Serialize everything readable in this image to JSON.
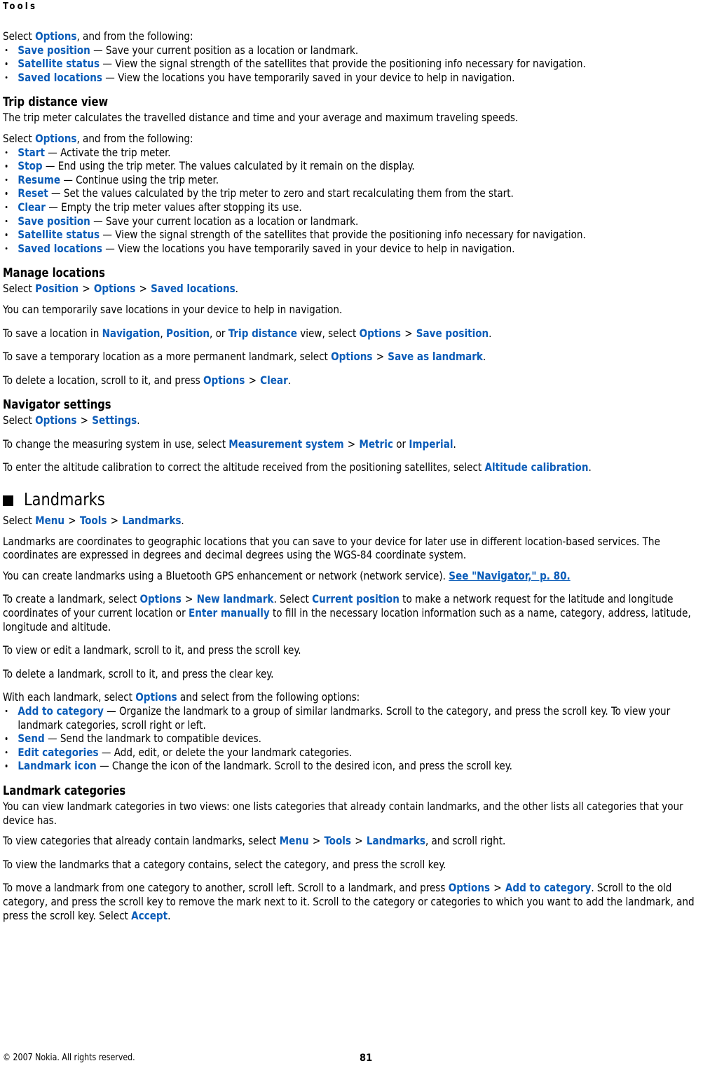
{
  "running_head": "Tools",
  "colors": {
    "ui_term": "#0a5cb8",
    "text": "#000000",
    "background": "#ffffff"
  },
  "position_view": {
    "intro": {
      "pre": "Select ",
      "term": "Options",
      "post": ", and from the following:"
    },
    "items": [
      {
        "term": "Save position",
        "desc": "— Save your current position as a location or landmark."
      },
      {
        "term": "Satellite status",
        "desc": "— View the signal strength of the satellites that provide the positioning info necessary for navigation."
      },
      {
        "term": "Saved locations",
        "desc": "— View the locations you have temporarily saved in your device to help in navigation."
      }
    ]
  },
  "trip_distance": {
    "heading": "Trip distance view",
    "body": "The trip meter calculates the travelled distance and time and your average and maximum traveling speeds.",
    "intro": {
      "pre": "Select ",
      "term": "Options",
      "post": ", and from the following:"
    },
    "items": [
      {
        "term": "Start",
        "desc": "— Activate the trip meter."
      },
      {
        "term": "Stop",
        "desc": "— End using the trip meter. The values calculated by it remain on the display."
      },
      {
        "term": "Resume",
        "desc": "— Continue using the trip meter."
      },
      {
        "term": "Reset",
        "desc": "— Set the values calculated by the trip meter to zero and start recalculating them from the start."
      },
      {
        "term": "Clear",
        "desc": "— Empty the trip meter values after stopping its use."
      },
      {
        "term": "Save position",
        "desc": "— Save your current location as a location or landmark."
      },
      {
        "term": "Satellite status",
        "desc": "— View the signal strength of the satellites that provide the positioning info necessary for navigation."
      },
      {
        "term": "Saved locations",
        "desc": "— View the locations you have temporarily saved in your device to help in navigation."
      }
    ]
  },
  "manage_locations": {
    "heading": "Manage locations",
    "path": {
      "pre": "Select ",
      "t1": "Position",
      "s1": ">",
      "t2": "Options",
      "s2": ">",
      "t3": "Saved locations",
      "post": "."
    },
    "p1": "You can temporarily save locations in your device to help in navigation.",
    "p2": {
      "a": "To save a location in ",
      "t1": "Navigation",
      "b": ", ",
      "t2": "Position",
      "c": ", or ",
      "t3": "Trip distance",
      "d": " view, select ",
      "t4": "Options",
      "s1": ">",
      "t5": "Save position",
      "e": "."
    },
    "p3": {
      "a": "To save a temporary location as a more permanent landmark, select ",
      "t1": "Options",
      "s1": ">",
      "t2": "Save as landmark",
      "b": "."
    },
    "p4": {
      "a": "To delete a location, scroll to it, and press ",
      "t1": "Options",
      "s1": ">",
      "t2": "Clear",
      "b": "."
    }
  },
  "navigator_settings": {
    "heading": "Navigator settings",
    "path": {
      "pre": "Select ",
      "t1": "Options",
      "s1": ">",
      "t2": "Settings",
      "post": "."
    },
    "p1": {
      "a": "To change the measuring system in use, select ",
      "t1": "Measurement system",
      "s1": ">",
      "t2": "Metric",
      "b": " or ",
      "t3": "Imperial",
      "c": "."
    },
    "p2": {
      "a": "To enter the altitude calibration to correct the altitude received from the positioning satellites, select ",
      "t1": "Altitude calibration",
      "b": "."
    }
  },
  "landmarks": {
    "chapter_title": "Landmarks",
    "path": {
      "pre": "Select ",
      "t1": "Menu",
      "s1": ">",
      "t2": "Tools",
      "s2": ">",
      "t3": "Landmarks",
      "post": "."
    },
    "p1": "Landmarks are coordinates to geographic locations that you can save to your device for later use in different location-based services. The coordinates are expressed in degrees and decimal degrees using the WGS-84 coordinate system.",
    "p2": {
      "a": "You can create landmarks using a Bluetooth GPS enhancement or network (network service). ",
      "link": "See \"Navigator,\" p. 80."
    },
    "p3": {
      "a": "To create a landmark, select ",
      "t1": "Options",
      "s1": ">",
      "t2": "New landmark",
      "b": ". Select ",
      "t3": "Current position",
      "c": " to make a network request for the latitude and longitude coordinates of your current location or ",
      "t4": "Enter manually",
      "d": " to fill in the necessary location information such as a name, category, address, latitude, longitude and altitude."
    },
    "p4": "To view or edit a landmark, scroll to it, and press the scroll key.",
    "p5": "To delete a landmark, scroll to it, and press the clear key.",
    "p6": {
      "a": "With each landmark, select ",
      "t1": "Options",
      "b": " and select from the following options:"
    },
    "items": [
      {
        "term": "Add to category",
        "desc": "— Organize the landmark to a group of similar landmarks. Scroll to the category, and press the scroll key. To view your landmark categories, scroll right or left."
      },
      {
        "term": "Send",
        "desc": "— Send the landmark to compatible devices."
      },
      {
        "term": "Edit categories",
        "desc": "— Add, edit, or delete the your landmark categories."
      },
      {
        "term": "Landmark icon",
        "desc": "— Change the icon of the landmark. Scroll to the desired icon, and press the scroll key."
      }
    ]
  },
  "landmark_categories": {
    "heading": "Landmark categories",
    "p1": "You can view landmark categories in two views: one lists categories that already contain landmarks, and the other lists all categories that your device has.",
    "p2": {
      "a": "To view categories that already contain landmarks, select ",
      "t1": "Menu",
      "s1": ">",
      "t2": "Tools",
      "s2": ">",
      "t3": "Landmarks",
      "b": ", and scroll right."
    },
    "p3": "To view the landmarks that a category contains, select the category, and press the scroll key.",
    "p4": {
      "a": "To move a landmark from one category to another, scroll left. Scroll to a landmark, and press ",
      "t1": "Options",
      "s1": ">",
      "t2": "Add to category",
      "b": ". Scroll to the old category, and press the scroll key to remove the mark next to it. Scroll to the category or categories to which you want to add the landmark, and press the scroll key. Select ",
      "t3": "Accept",
      "c": "."
    }
  },
  "footer": {
    "copyright": "© 2007 Nokia. All rights reserved.",
    "page_number": "81"
  }
}
